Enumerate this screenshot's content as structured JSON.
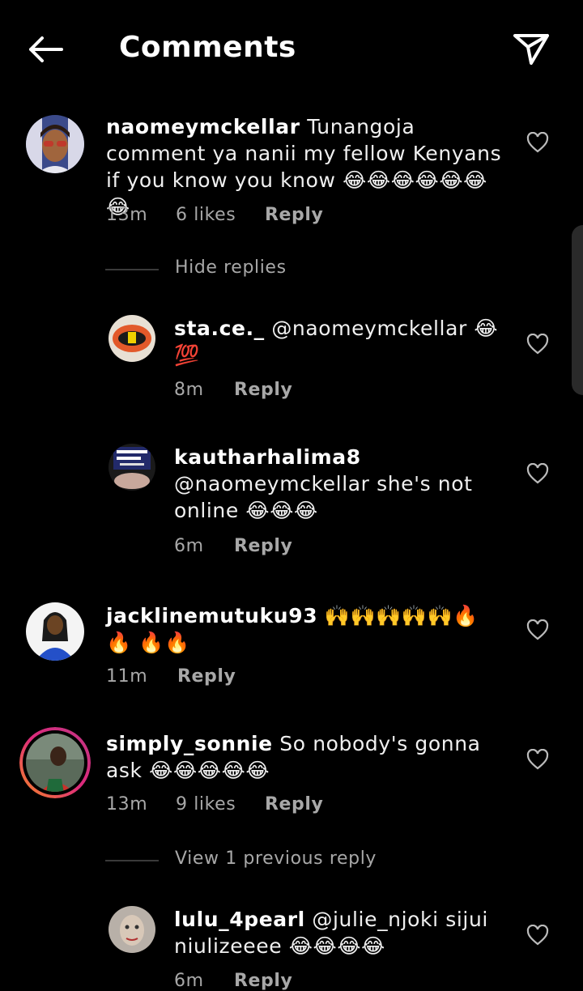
{
  "header": {
    "title": "Comments"
  },
  "comments": [
    {
      "username": "naomeymckellar",
      "text": " Tunangoja comment ya nanii my fellow Kenyans if you know you know 😂😂😂😂😂😂😂",
      "time": "13m",
      "likes": "6 likes",
      "reply": "Reply",
      "toggle": "Hide replies"
    },
    {
      "username": "sta.ce._",
      "text": " @naomeymckellar 😂 💯",
      "time": "8m",
      "reply": "Reply"
    },
    {
      "username": "kautharhalima8",
      "text": "@naomeymckellar she's not online 😂😂😂",
      "time": "6m",
      "reply": "Reply"
    },
    {
      "username": "jacklinemutuku93",
      "text": " 🙌🙌🙌🙌🙌🔥🔥 🔥🔥",
      "time": "11m",
      "reply": "Reply"
    },
    {
      "username": "simply_sonnie",
      "text": " So nobody's gonna ask 😂😂😂😂😂",
      "time": "13m",
      "likes": "9 likes",
      "reply": "Reply",
      "toggle": "View 1 previous reply"
    },
    {
      "username": "lulu_4pearl",
      "text": " @julie_njoki sijui niulizeeee 😂😂😂😂",
      "time": "6m",
      "reply": "Reply"
    }
  ],
  "colors": {
    "background": "#000000",
    "text": "#f5f5f5",
    "muted": "#a8a8a8",
    "story_ring": "#e1306c"
  }
}
